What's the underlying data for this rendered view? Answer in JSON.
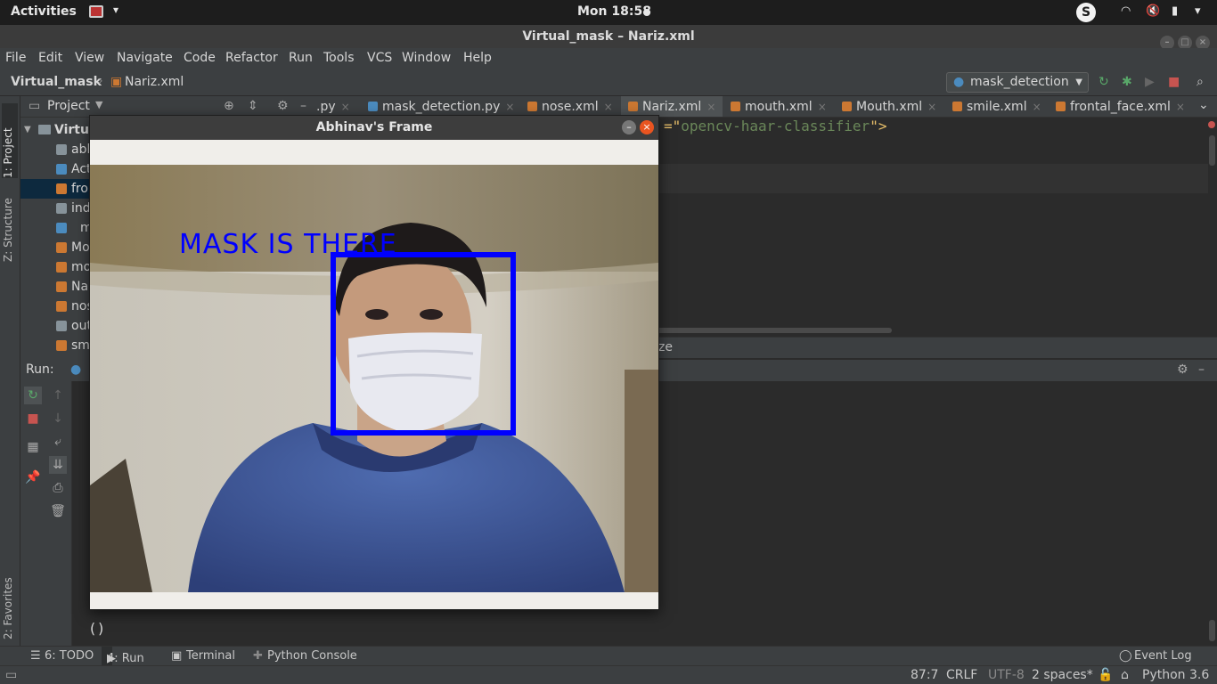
{
  "topbar": {
    "activities": "Activities",
    "clock": "Mon 18:58",
    "skype_icon": "skype-icon"
  },
  "window": {
    "title": "Virtual_mask – Nariz.xml"
  },
  "menu": {
    "items": [
      "File",
      "Edit",
      "View",
      "Navigate",
      "Code",
      "Refactor",
      "Run",
      "Tools",
      "VCS",
      "Window",
      "Help"
    ]
  },
  "navbar": {
    "project": "Virtual_mask",
    "file": "Nariz.xml",
    "run_config": "mask_detection"
  },
  "project_panel": {
    "title": "Project",
    "root": "Virtu",
    "items": [
      "abl",
      "Act",
      "fro",
      "ind",
      "m",
      "Mo",
      "mo",
      "Na",
      "nos",
      "out",
      "sm"
    ]
  },
  "left_strip": {
    "project_tab": "1: Project",
    "structure_tab": "Z: Structure",
    "favorites_tab": "2: Favorites"
  },
  "editor": {
    "tabs": [
      {
        "label": ".py",
        "type": "py"
      },
      {
        "label": "mask_detection.py",
        "type": "py"
      },
      {
        "label": "nose.xml",
        "type": "xml"
      },
      {
        "label": "Nariz.xml",
        "type": "xml"
      },
      {
        "label": "mouth.xml",
        "type": "xml"
      },
      {
        "label": "Mouth.xml",
        "type": "xml"
      },
      {
        "label": "smile.xml",
        "type": "xml"
      },
      {
        "label": "frontal_face.xml",
        "type": "xml"
      }
    ],
    "code_prefix": "=\"",
    "code_value": "opencv-haar-classifier",
    "code_suffix": "\">",
    "status_fragment": "ze"
  },
  "run_panel": {
    "label": "Run:",
    "console_output": "()"
  },
  "bottom_tabs": {
    "todo": "6: TODO",
    "run": "4: Run",
    "terminal": "Terminal",
    "python_console": "Python Console",
    "event_log": "Event Log"
  },
  "statusbar": {
    "position": "87:7",
    "line_sep": "CRLF",
    "encoding": "UTF-8",
    "indent": "2 spaces*",
    "interpreter": "Python 3.6"
  },
  "frame": {
    "title": "Abhinav's Frame",
    "caption": "MASK IS THERE"
  }
}
